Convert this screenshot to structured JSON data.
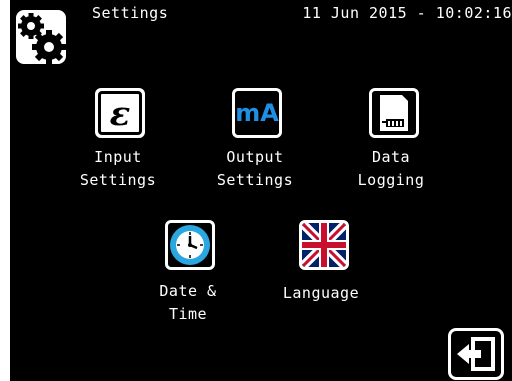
{
  "header": {
    "title": "Settings",
    "datetime": "11 Jun 2015 - 10:02:16"
  },
  "menu": {
    "input": {
      "line1": "Input",
      "line2": "Settings",
      "icon_glyph": "ε"
    },
    "output": {
      "line1": "Output",
      "line2": "Settings",
      "icon_text": "mA"
    },
    "logging": {
      "line1": "Data",
      "line2": "Logging"
    },
    "datetime": {
      "line1": "Date &",
      "line2": "Time"
    },
    "language": {
      "line1": "Language"
    }
  },
  "icons": {
    "home": "gears-icon",
    "input": "epsilon-icon",
    "output": "milliamp-icon",
    "logging": "sd-card-icon",
    "datetime": "clock-icon",
    "language": "uk-flag-icon",
    "exit": "exit-icon"
  },
  "colors": {
    "background": "#000000",
    "text": "#ffffff",
    "ma_blue": "#1f8fe6",
    "clock_blue": "#2aa7e0"
  }
}
